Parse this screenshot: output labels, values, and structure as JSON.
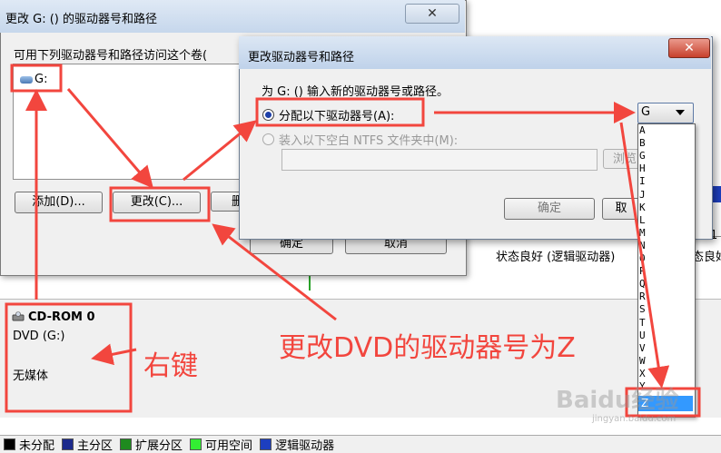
{
  "background": {
    "status_logical": "状态良好 (逻辑驱动器)",
    "status_logical_2": "态良好",
    "partition_num": "1",
    "ok_label": "确定",
    "cancel_label": "取消"
  },
  "cdrom": {
    "title": "CD-ROM 0",
    "type": "DVD (G:)",
    "media": "无媒体"
  },
  "legend": [
    {
      "label": "未分配",
      "color": "#000000"
    },
    {
      "label": "主分区",
      "color": "#1c2a8c"
    },
    {
      "label": "扩展分区",
      "color": "#1f8a1f"
    },
    {
      "label": "可用空间",
      "color": "#33ee33"
    },
    {
      "label": "逻辑驱动器",
      "color": "#1d3fbf"
    }
  ],
  "window1": {
    "title": "更改 G: () 的驱动器号和路径",
    "close": "✕",
    "list_label": "可用下列驱动器号和路径访问这个卷(",
    "item": "G:",
    "add_btn": "添加(D)...",
    "change_btn": "更改(C)...",
    "delete_btn": "删"
  },
  "window2": {
    "title": "更改驱动器号和路径",
    "close": "✕",
    "prompt": "为 G: () 输入新的驱动器号或路径。",
    "option_assign": "分配以下驱动器号(A):",
    "option_mount": "装入以下空白 NTFS 文件夹中(M):",
    "browse_btn": "浏览",
    "ok_btn": "确定",
    "cancel_btn": "取",
    "combo_value": "G",
    "letters": [
      "A",
      "B",
      "G",
      "H",
      "I",
      "J",
      "K",
      "L",
      "M",
      "N",
      "O",
      "P",
      "Q",
      "R",
      "S",
      "T",
      "U",
      "V",
      "W",
      "X",
      "Y"
    ],
    "selected_option": "Z"
  },
  "annotations": {
    "main": "更改DVD的驱动器号为Z",
    "right_click": "右键",
    "watermark": "Baidu经验",
    "watermark_url": "jingyan.baidu.com"
  },
  "colors": {
    "annotation_red": "#f2463e",
    "selected_blue": "#3399ff"
  }
}
